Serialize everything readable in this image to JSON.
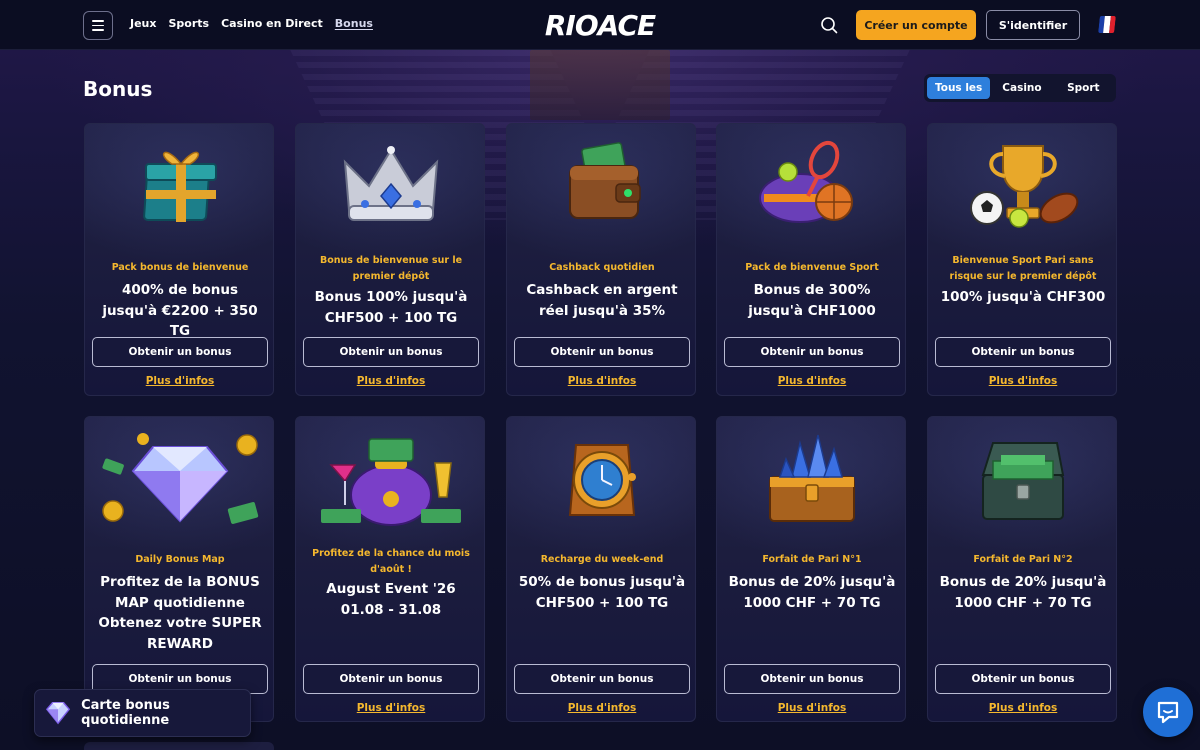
{
  "header": {
    "nav": [
      "Jeux",
      "Sports",
      "Casino en Direct",
      "Bonus"
    ],
    "logo": "RIOACE",
    "register_label": "Créer un compte",
    "login_label": "S'identifier"
  },
  "page": {
    "title": "Bonus",
    "filters": [
      "Tous les",
      "Casino",
      "Sport"
    ],
    "selected_filter": "Tous les"
  },
  "cards": [
    {
      "category": "Pack bonus de bienvenue",
      "title": "400% de bonus jusqu'à €2200 + 350 TG",
      "button": "Obtenir un bonus",
      "more": "Plus d'infos",
      "icon": "gift-box-icon"
    },
    {
      "category": "Bonus de bienvenue sur le premier dépôt",
      "title": "Bonus 100% jusqu'à CHF500 + 100 TG",
      "button": "Obtenir un bonus",
      "more": "Plus d'infos",
      "icon": "crown-icon"
    },
    {
      "category": "Cashback quotidien",
      "title": "Cashback en argent réel jusqu'à 35%",
      "button": "Obtenir un bonus",
      "more": "Plus d'infos",
      "icon": "wallet-icon"
    },
    {
      "category": "Pack de bienvenue Sport",
      "title": "Bonus de 300% jusqu'à CHF1000",
      "button": "Obtenir un bonus",
      "more": "Plus d'infos",
      "icon": "sports-bag-icon"
    },
    {
      "category": "Bienvenue Sport Pari sans risque sur le premier dépôt",
      "title": "100% jusqu'à CHF300",
      "button": "Obtenir un bonus",
      "more": "Plus d'infos",
      "icon": "trophy-balls-icon"
    },
    {
      "category": "Daily Bonus Map",
      "title": "Profitez de la BONUS MAP quotidienne Obtenez votre SUPER REWARD",
      "button": "Obtenir un bonus",
      "more": "",
      "icon": "diamond-icon"
    },
    {
      "category": "Profitez de la chance du mois d'août !",
      "title": "August Event '26 01.08 - 31.08",
      "button": "Obtenir un bonus",
      "more": "Plus d'infos",
      "icon": "money-bag-icon"
    },
    {
      "category": "Recharge du week-end",
      "title": "50% de bonus jusqu'à CHF500 + 100 TG",
      "button": "Obtenir un bonus",
      "more": "Plus d'infos",
      "icon": "watch-icon"
    },
    {
      "category": "Forfait de Pari N°1",
      "title": "Bonus de 20% jusqu'à 1000 CHF + 70 TG",
      "button": "Obtenir un bonus",
      "more": "Plus d'infos",
      "icon": "crystal-chest-icon"
    },
    {
      "category": "Forfait de Pari N°2",
      "title": "Bonus de 20% jusqu'à 1000 CHF + 70 TG",
      "button": "Obtenir un bonus",
      "more": "Plus d'infos",
      "icon": "cash-chest-icon"
    }
  ],
  "daily_card": {
    "label": "Carte bonus quotidienne"
  },
  "colors": {
    "accent": "#f5a51f",
    "filter_active": "#2e7fdc",
    "category_text": "#f5b82e",
    "chat": "#1f6fd6"
  }
}
